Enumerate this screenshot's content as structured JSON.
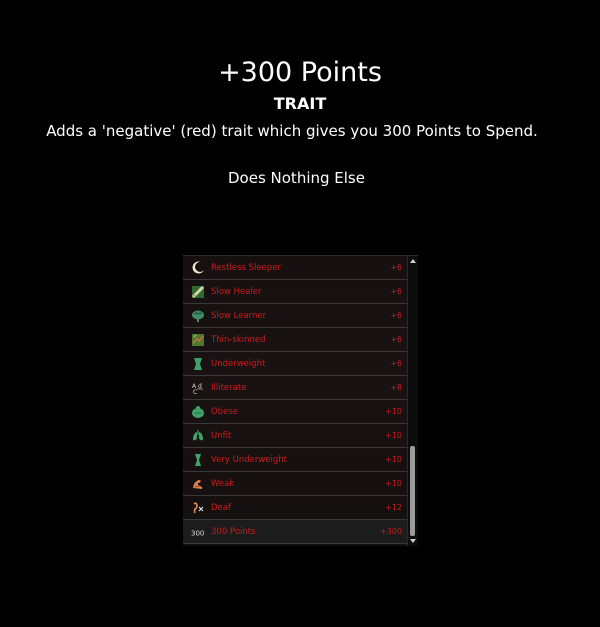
{
  "header": {
    "title": "+300 Points",
    "subtitle": "TRAIT",
    "description": "Adds a 'negative' (red) trait which gives you 300 Points to Spend.",
    "note": "Does Nothing Else"
  },
  "traits": [
    {
      "name": "Restless Sleeper",
      "points": "+6",
      "icon": "moon-icon"
    },
    {
      "name": "Slow Healer",
      "points": "+6",
      "icon": "bandage-icon"
    },
    {
      "name": "Slow Learner",
      "points": "+6",
      "icon": "brain-icon"
    },
    {
      "name": "Thin-skinned",
      "points": "+6",
      "icon": "skin-icon"
    },
    {
      "name": "Underweight",
      "points": "+6",
      "icon": "thin-body-icon"
    },
    {
      "name": "Illiterate",
      "points": "+8",
      "icon": "abc-icon"
    },
    {
      "name": "Obese",
      "points": "+10",
      "icon": "obese-body-icon"
    },
    {
      "name": "Unfit",
      "points": "+10",
      "icon": "lungs-icon"
    },
    {
      "name": "Very Underweight",
      "points": "+10",
      "icon": "very-thin-body-icon"
    },
    {
      "name": "Weak",
      "points": "+10",
      "icon": "arm-icon"
    },
    {
      "name": "Deaf",
      "points": "+12",
      "icon": "deaf-icon"
    },
    {
      "name": "300 Points",
      "points": "+300",
      "icon": "300-icon",
      "icon_text": "300"
    }
  ],
  "colors": {
    "background": "#000000",
    "trait_text": "#cc1b1b",
    "header_text": "#ffffff"
  }
}
